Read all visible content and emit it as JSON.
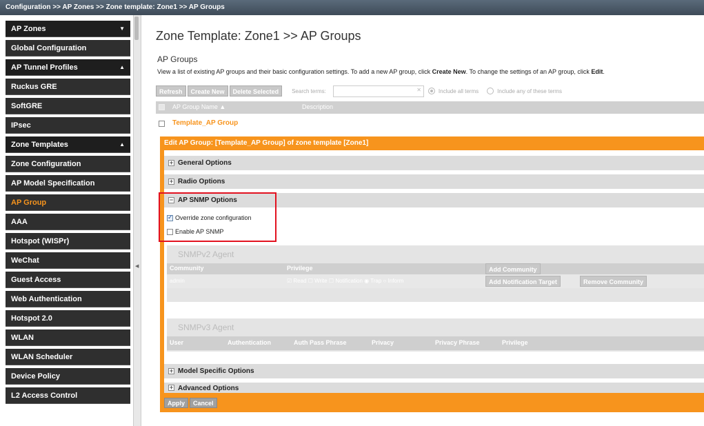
{
  "breadcrumb": "Configuration >> AP Zones >> Zone template: Zone1 >> AP Groups",
  "sidebar": {
    "items": [
      {
        "label": "AP Zones",
        "type": "group",
        "arrow": "▼"
      },
      {
        "label": "Global Configuration",
        "type": "item"
      },
      {
        "label": "AP Tunnel Profiles",
        "type": "group",
        "arrow": "▲"
      },
      {
        "label": "Ruckus GRE",
        "type": "item"
      },
      {
        "label": "SoftGRE",
        "type": "item"
      },
      {
        "label": "IPsec",
        "type": "item"
      },
      {
        "label": "Zone Templates",
        "type": "group",
        "arrow": "▲"
      },
      {
        "label": "Zone Configuration",
        "type": "item"
      },
      {
        "label": "AP Model Specification",
        "type": "item"
      },
      {
        "label": "AP Group",
        "type": "item",
        "active": true
      },
      {
        "label": "AAA",
        "type": "item"
      },
      {
        "label": "Hotspot (WISPr)",
        "type": "item"
      },
      {
        "label": "WeChat",
        "type": "item"
      },
      {
        "label": "Guest Access",
        "type": "item"
      },
      {
        "label": "Web Authentication",
        "type": "item"
      },
      {
        "label": "Hotspot 2.0",
        "type": "item"
      },
      {
        "label": "WLAN",
        "type": "item"
      },
      {
        "label": "WLAN Scheduler",
        "type": "item"
      },
      {
        "label": "Device Policy",
        "type": "item"
      },
      {
        "label": "L2 Access Control",
        "type": "item"
      }
    ]
  },
  "main": {
    "page_title": "Zone Template: Zone1 >> AP Groups",
    "subtitle": "AP Groups",
    "description_prefix": "View a list of existing AP groups and their basic configuration settings. To add a new AP group, click ",
    "description_create": "Create New",
    "description_mid": ". To change the settings of an AP group, click ",
    "description_edit": "Edit",
    "description_end": ".",
    "toolbar": {
      "refresh": "Refresh",
      "create_new": "Create New",
      "delete_selected": "Delete Selected",
      "search_label": "Search terms:",
      "search_value": "",
      "clear": "✕",
      "include_all": "Include all terms",
      "include_any": "Include any of these terms"
    },
    "table": {
      "col_name": "AP Group Name ▲",
      "col_desc": "Description",
      "rows": [
        {
          "name": "Template_AP Group",
          "description": ""
        }
      ]
    },
    "edit": {
      "header": "Edit AP Group: [Template_AP Group] of zone template [Zone1]",
      "general": "General Options",
      "radio": "Radio Options",
      "snmp": "AP SNMP Options",
      "override": "Override zone configuration",
      "override_checked": true,
      "enable_snmp": "Enable AP SNMP",
      "enable_snmp_checked": false,
      "snmpv2": {
        "title": "SNMPv2 Agent",
        "col_community": "Community",
        "col_privilege": "Privilege",
        "add_community": "Add Community",
        "row_community": "admin",
        "read": "Read",
        "write": "Write",
        "notification": "Notification",
        "trap": "Trap",
        "inform": "Inform",
        "add_target": "Add Notification Target",
        "remove_community": "Remove Community"
      },
      "snmpv3": {
        "title": "SNMPv3 Agent",
        "col_user": "User",
        "col_auth": "Authentication",
        "col_auth_pass": "Auth Pass Phrase",
        "col_privacy": "Privacy",
        "col_privacy_pass": "Privacy Phrase",
        "col_privilege": "Privilege"
      },
      "model_specific": "Model Specific Options",
      "advanced": "Advanced Options",
      "apply": "Apply",
      "cancel": "Cancel"
    }
  },
  "colors": {
    "accent": "#f7941d",
    "highlight": "#e2111f",
    "sidebar": "#2f2f2f"
  }
}
